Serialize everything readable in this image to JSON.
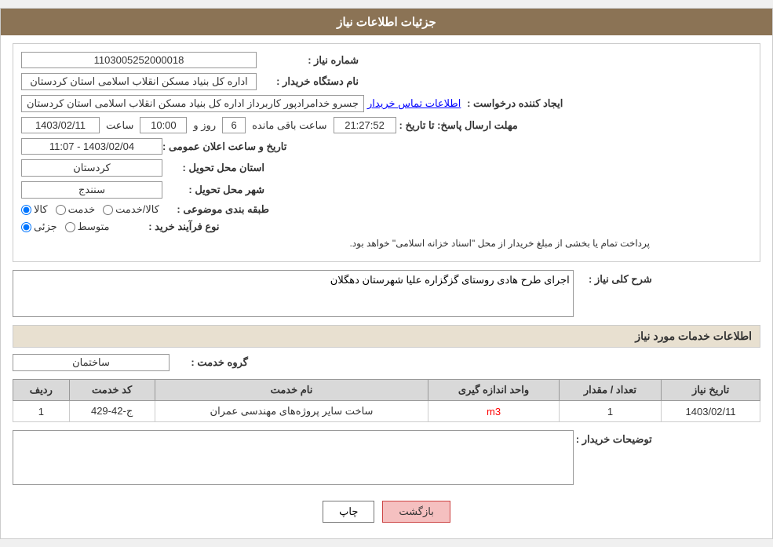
{
  "header": {
    "title": "جزئیات اطلاعات نیاز"
  },
  "fields": {
    "need_number_label": "شماره نیاز :",
    "need_number_value": "1103005252000018",
    "buyer_org_label": "نام دستگاه خریدار :",
    "buyer_org_value": "اداره کل بنیاد مسکن انقلاب اسلامی استان کردستان",
    "creator_label": "ایجاد کننده درخواست :",
    "creator_value": "جسرو خدامرادپور کاربرداز اداره کل بنیاد مسکن انقلاب اسلامی استان کردستان",
    "contact_link": "اطلاعات تماس خریدار",
    "deadline_label": "مهلت ارسال پاسخ: تا تاریخ :",
    "deadline_date": "1403/02/11",
    "deadline_time_label": "ساعت",
    "deadline_time": "10:00",
    "deadline_day_label": "روز و",
    "deadline_days": "6",
    "deadline_remaining_label": "ساعت باقی مانده",
    "deadline_remaining": "21:27:52",
    "announce_label": "تاریخ و ساعت اعلان عمومی :",
    "announce_value": "1403/02/04 - 11:07",
    "province_label": "استان محل تحویل :",
    "province_value": "کردستان",
    "city_label": "شهر محل تحویل :",
    "city_value": "سنندج",
    "category_label": "طبقه بندی موضوعی :",
    "category_kala": "کالا",
    "category_khedmat": "خدمت",
    "category_kala_khedmat": "کالا/خدمت",
    "process_label": "نوع فرآیند خرید :",
    "process_jozi": "جزئی",
    "process_mottasat": "متوسط",
    "process_note": "پرداخت تمام یا بخشی از مبلغ خریدار از محل \"اسناد خزانه اسلامی\" خواهد بود.",
    "description_label": "شرح کلی نیاز :",
    "description_value": "اجرای طرح هادی روستای گزگزاره علیا شهرستان دهگلان",
    "services_title": "اطلاعات خدمات مورد نیاز",
    "service_group_label": "گروه خدمت :",
    "service_group_value": "ساختمان",
    "table_headers": {
      "row_num": "ردیف",
      "service_code": "کد خدمت",
      "service_name": "نام خدمت",
      "unit": "واحد اندازه گیری",
      "quantity": "تعداد / مقدار",
      "date": "تاریخ نیاز"
    },
    "table_rows": [
      {
        "row_num": "1",
        "service_code": "ج-42-429",
        "service_name": "ساخت سایر پروژه‌های مهندسی عمران",
        "unit": "m3",
        "quantity": "1",
        "date": "1403/02/11"
      }
    ],
    "buyer_notes_label": "توضیحات خریدار :",
    "buyer_notes_value": ""
  },
  "buttons": {
    "print_label": "چاپ",
    "back_label": "بازگشت"
  }
}
